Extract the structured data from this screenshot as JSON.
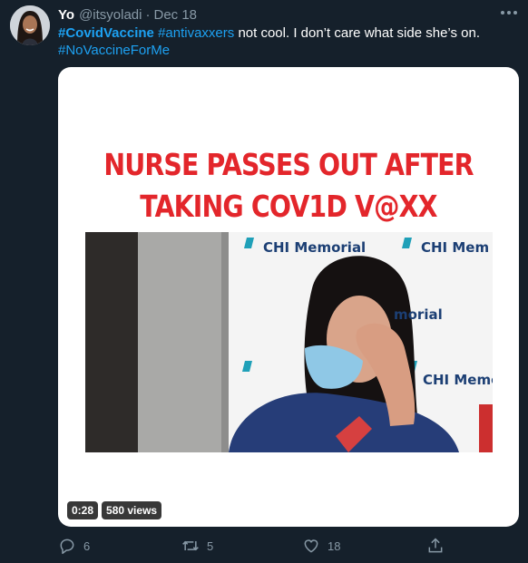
{
  "tweet": {
    "author_name": "Yo",
    "handle": "@itsyoladi",
    "separator": "·",
    "date": "Dec 18",
    "text": {
      "hashtag_1": "#CovidVaccine",
      "hashtag_2": "#antivaxxers",
      "body": " not cool. I don’t care what side she’s on.",
      "hashtag_3": "#NoVaccineForMe"
    }
  },
  "media": {
    "headline_line_1": "NURSE PASSES OUT AFTER",
    "headline_line_2": "TAKING COV1D V@XX",
    "backdrop_logos": [
      "CHI Memorial",
      "CHI Mem",
      "morial",
      "CHI Memo"
    ],
    "duration": "0:28",
    "views": "580 views"
  },
  "actions": {
    "replies": "6",
    "retweets": "5",
    "likes": "18"
  },
  "colors": {
    "background": "#15202b",
    "accent": "#1da1f2",
    "muted": "#8899a6",
    "headline_red": "#e3262b"
  },
  "icons": [
    "more-icon",
    "reply-icon",
    "retweet-icon",
    "like-icon",
    "share-icon"
  ]
}
